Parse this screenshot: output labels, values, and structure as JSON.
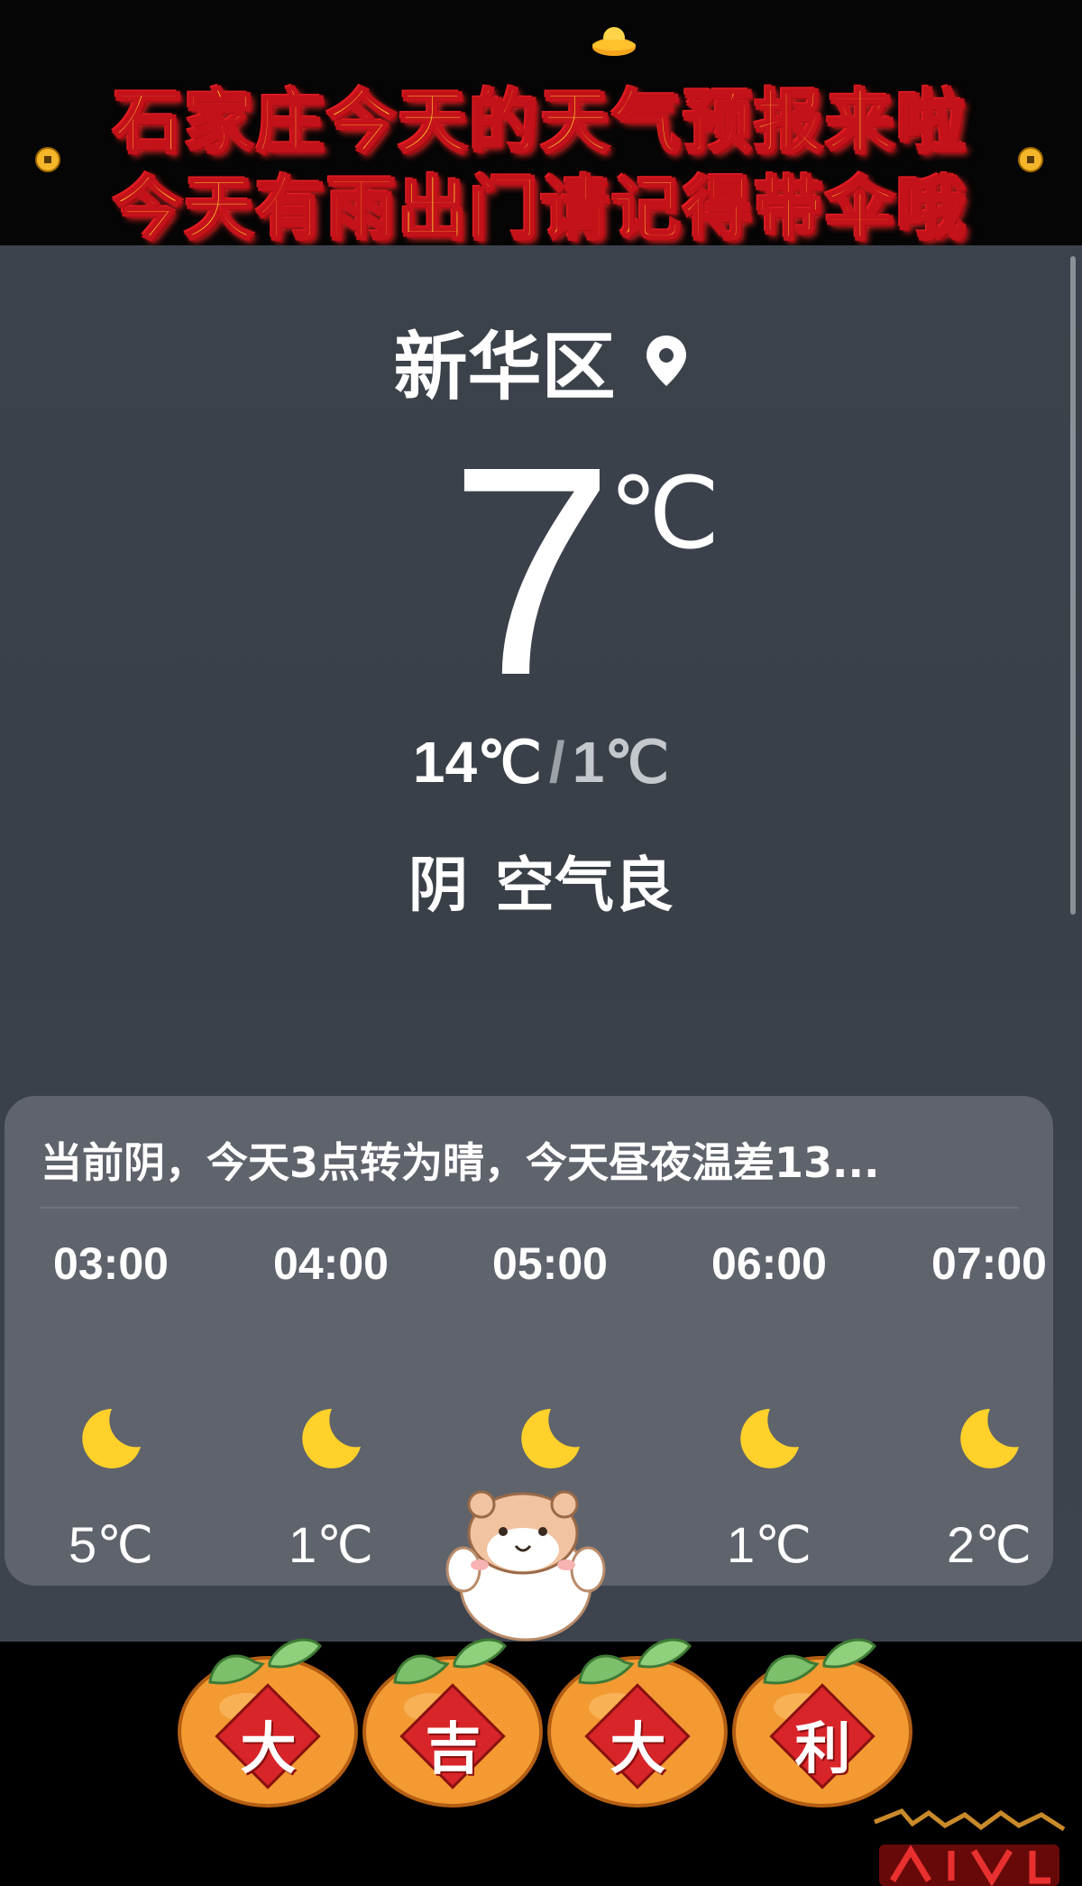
{
  "banner": {
    "line1": "石家庄今天的天气预报来啦",
    "line2": "今天有雨出门请记得带伞哦"
  },
  "location": {
    "name": "新华区",
    "icon": "location-pin-icon"
  },
  "current": {
    "temperature": "7",
    "unit": "℃",
    "high": "14℃",
    "separator": "/",
    "low": "1℃",
    "condition": "阴",
    "air_quality": "空气良"
  },
  "forecast": {
    "summary": "当前阴，今天3点转为晴，今天昼夜温差13...",
    "hours": [
      {
        "time": "03:00",
        "icon": "moon-icon",
        "temp": "5℃"
      },
      {
        "time": "04:00",
        "icon": "moon-icon",
        "temp": "1℃"
      },
      {
        "time": "05:00",
        "icon": "moon-icon",
        "temp": ""
      },
      {
        "time": "06:00",
        "icon": "moon-icon",
        "temp": "1℃"
      },
      {
        "time": "07:00",
        "icon": "moon-icon",
        "temp": "2℃"
      }
    ]
  },
  "stickers": {
    "oranges": [
      "大",
      "吉",
      "大",
      "利"
    ]
  },
  "colors": {
    "screen_bg": "#3c424b",
    "card_bg": "#5e636c",
    "moon": "#ffd12a",
    "banner_text": "#ffcf2e",
    "banner_outline": "#c4121a"
  }
}
